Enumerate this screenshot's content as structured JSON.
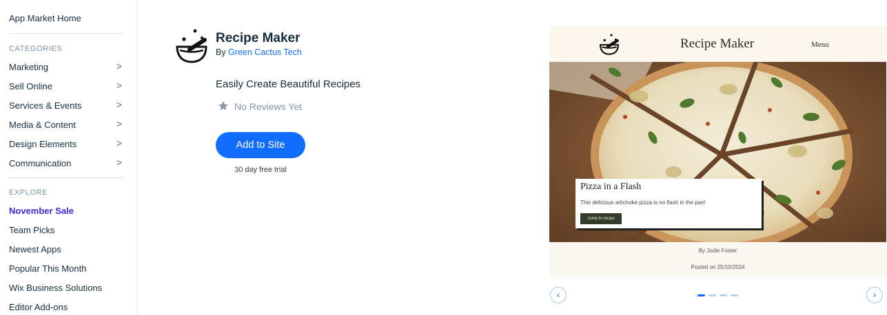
{
  "sidebar": {
    "home_label": "App Market Home",
    "categories_heading": "CATEGORIES",
    "categories": [
      {
        "label": "Marketing"
      },
      {
        "label": "Sell Online"
      },
      {
        "label": "Services & Events"
      },
      {
        "label": "Media & Content"
      },
      {
        "label": "Design Elements"
      },
      {
        "label": "Communication"
      }
    ],
    "explore_heading": "EXPLORE",
    "explore": [
      {
        "label": "November Sale",
        "active": true
      },
      {
        "label": "Team Picks"
      },
      {
        "label": "Newest Apps"
      },
      {
        "label": "Popular This Month"
      },
      {
        "label": "Wix Business Solutions"
      },
      {
        "label": "Editor Add-ons"
      }
    ],
    "chevron": ">"
  },
  "app": {
    "name": "Recipe Maker",
    "by_prefix": "By ",
    "developer": "Green Cactus Tech",
    "tagline": "Easily Create Beautiful Recipes",
    "reviews": "No Reviews Yet",
    "add_button": "Add to Site",
    "trial": "30 day free trial"
  },
  "preview": {
    "site_title": "Recipe Maker",
    "menu": "Menu",
    "card_title": "Pizza in a Flash",
    "card_desc": "This delicious artichoke pizza is no flash in the pan!",
    "card_button": "Jump to recipe",
    "author": "By Jodie Foster",
    "posted": "Posted on 25/10/2024"
  },
  "carousel": {
    "prev": "‹",
    "next": "›",
    "slide_count": 4,
    "active_index": 0
  },
  "colors": {
    "accent": "#116dff",
    "active_nav": "#3b2bd9"
  }
}
